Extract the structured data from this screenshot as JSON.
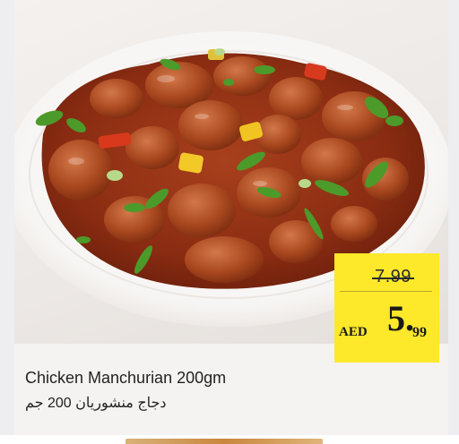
{
  "product": {
    "name_en": "Chicken Manchurian 200gm",
    "name_ar": "دجاج منشوريان 200 جم",
    "image_icon": "chicken-manchurian-photo"
  },
  "price": {
    "old": "7.99",
    "currency": "AED",
    "new_int": "5.",
    "new_dec": "99"
  },
  "colors": {
    "tag": "#fde829",
    "sauce": "#8a2c12",
    "plate": "#fbfaf9"
  }
}
